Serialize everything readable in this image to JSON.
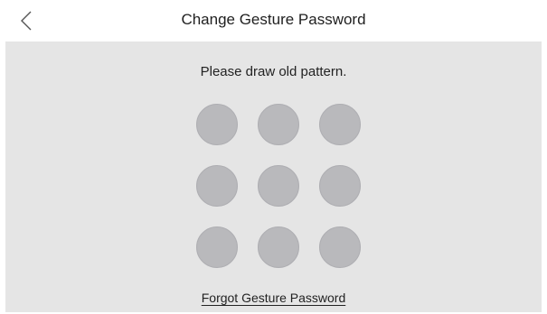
{
  "header": {
    "title": "Change Gesture Password",
    "back_icon": "chevron-left-icon"
  },
  "panel": {
    "prompt": "Please draw old pattern.",
    "forgot_link": "Forgot Gesture Password"
  },
  "pattern": {
    "rows": 3,
    "cols": 3,
    "selected": []
  },
  "colors": {
    "panel_bg": "#e5e5e5",
    "dot": "#b9b9bc",
    "text": "#222222"
  }
}
